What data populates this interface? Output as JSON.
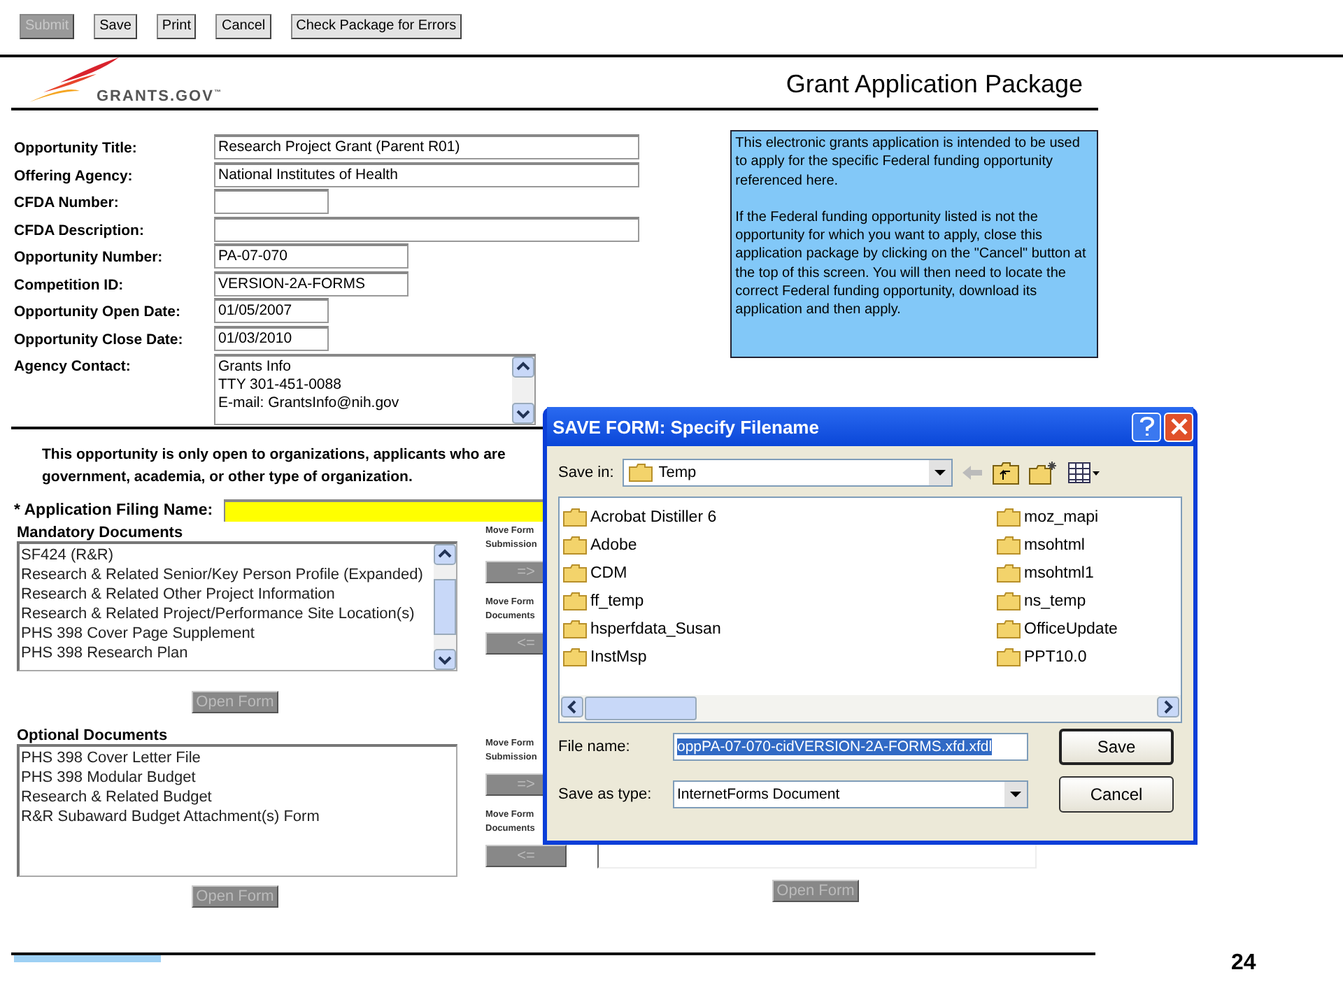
{
  "toolbar": [
    {
      "label": "Submit",
      "disabled": true
    },
    {
      "label": "Save",
      "disabled": false
    },
    {
      "label": "Print",
      "disabled": false
    },
    {
      "label": "Cancel",
      "disabled": false
    },
    {
      "label": "Check Package for Errors",
      "disabled": false
    }
  ],
  "header": {
    "logo": "GRANTS.GOV",
    "logo_mark": "™",
    "title": "Grant Application Package"
  },
  "fields": [
    {
      "label": "Opportunity Title:",
      "value": "Research Project Grant (Parent R01)",
      "kind": "wide"
    },
    {
      "label": "Offering Agency:",
      "value": "National Institutes of Health",
      "kind": "wide"
    },
    {
      "label": "CFDA Number:",
      "kind": "short"
    },
    {
      "label": "CFDA Description:",
      "kind": "wide"
    },
    {
      "label": "Opportunity Number:",
      "value": "PA-07-070",
      "kind": "medium"
    },
    {
      "label": "Competition ID:",
      "value": "VERSION-2A-FORMS",
      "kind": "medium"
    },
    {
      "label": "Opportunity Open Date:",
      "value": "01/05/2007",
      "kind": "short"
    },
    {
      "label": "Opportunity Close Date:",
      "value": "01/03/2010",
      "kind": "short"
    }
  ],
  "agency_contact": {
    "label": "Agency Contact:",
    "lines": [
      "Grants Info",
      "TTY 301-451-0088",
      "E-mail: GrantsInfo@nih.gov"
    ]
  },
  "info_box": [
    "This electronic grants application is intended to be used to apply for the specific Federal funding opportunity referenced here.",
    "If the Federal funding opportunity listed is not the opportunity for which you want to apply, close this application package by clicking on the \"Cancel\" button at the top of this screen. You will then need to locate the correct Federal funding opportunity, download its application and then apply."
  ],
  "notice": [
    "This opportunity is only open to organizations, applicants who are",
    "government, academia, or other type of organization."
  ],
  "filing_name": {
    "label": "* Application Filing Name:"
  },
  "sections": [
    {
      "title": "Mandatory Documents",
      "items": [
        "SF424 (R&R)",
        "Research & Related  Senior/Key Person Profile (Expanded)",
        "Research & Related Other Project Information",
        "Research & Related  Project/Performance Site Location(s)",
        "PHS 398 Cover Page Supplement",
        "PHS 398 Research Plan"
      ],
      "scrollable": true,
      "open_button": "Open Form",
      "moves": [
        {
          "label": [
            "Move Form",
            "Submission"
          ],
          "button": "=>"
        },
        {
          "label": [
            "Move Form",
            "Documents"
          ],
          "button": "<="
        }
      ]
    },
    {
      "title": "Optional Documents",
      "items": [
        "PHS 398 Cover Letter File",
        "PHS 398 Modular Budget",
        "Research & Related Budget",
        "R&R Subaward Budget Attachment(s) Form"
      ],
      "scrollable": false,
      "open_button": "Open Form",
      "moves": [
        {
          "label": [
            "Move Form",
            "Submission"
          ],
          "button": "=>"
        },
        {
          "label": [
            "Move Form",
            "Documents"
          ],
          "button": "<="
        }
      ]
    }
  ],
  "right_open_button": "Open Form",
  "dialog": {
    "title": "SAVE FORM: Specify Filename",
    "save_in_label": "Save in:",
    "save_in": "Temp",
    "folders": [
      [
        "Acrobat Distiller 6",
        "Adobe",
        "CDM",
        "ff_temp",
        "hsperfdata_Susan",
        "InstMsp"
      ],
      [
        "moz_mapi",
        "msohtml",
        "msohtml1",
        "ns_temp",
        "OfficeUpdate",
        "PPT10.0"
      ]
    ],
    "file_name_label": "File name:",
    "file_name": "oppPA-07-070-cidVERSION-2A-FORMS.xfd.xfdl",
    "type_label": "Save as type:",
    "type": "InternetForms Document",
    "buttons": [
      "Save",
      "Cancel"
    ]
  },
  "page_number": "24"
}
